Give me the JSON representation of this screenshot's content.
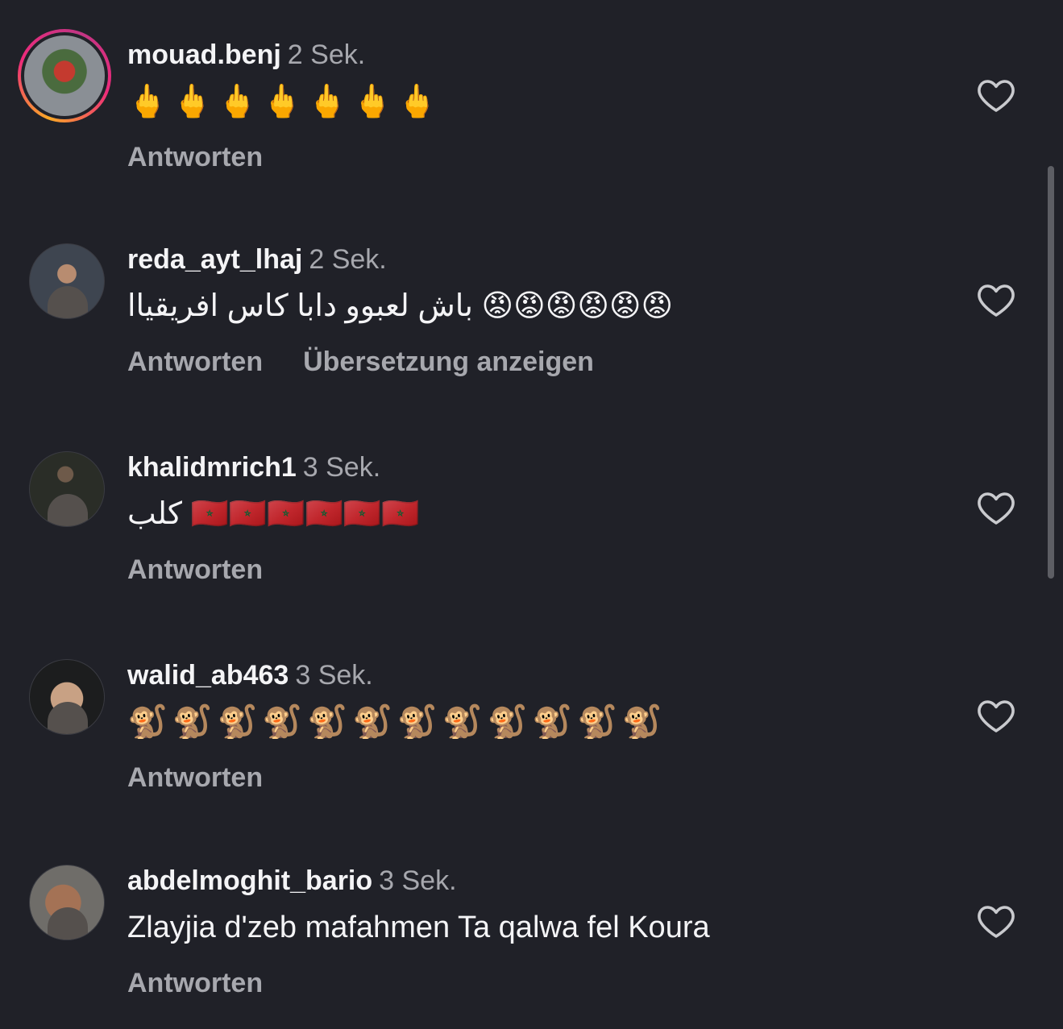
{
  "comments": [
    {
      "username": "mouad.benj",
      "time": "2 Sek.",
      "text": "🖕🖕🖕🖕🖕🖕🖕",
      "reply": "Antworten",
      "translate": ""
    },
    {
      "username": "reda_ayt_lhaj",
      "time": "2 Sek.",
      "text": "باش لعبوو دابا كاس افريقياا 😡😡😡😡😡😡",
      "reply": "Antworten",
      "translate": "Übersetzung anzeigen"
    },
    {
      "username": "khalidmrich1",
      "time": "3 Sek.",
      "text": "كلب 🇲🇦🇲🇦🇲🇦🇲🇦🇲🇦🇲🇦",
      "reply": "Antworten",
      "translate": ""
    },
    {
      "username": "walid_ab463",
      "time": "3 Sek.",
      "text": "🐒🐒🐒🐒🐒🐒🐒🐒🐒🐒🐒🐒",
      "reply": "Antworten",
      "translate": ""
    },
    {
      "username": "abdelmoghit_bario",
      "time": "3 Sek.",
      "text": "Zlayjia d'zeb mafahmen Ta qalwa fel Koura",
      "reply": "Antworten",
      "translate": ""
    }
  ],
  "icons": {
    "like": "heart-outline-icon"
  },
  "colors": {
    "background": "#202128",
    "primary_text": "#f4f4f6",
    "secondary_text": "#a7a8ae"
  }
}
